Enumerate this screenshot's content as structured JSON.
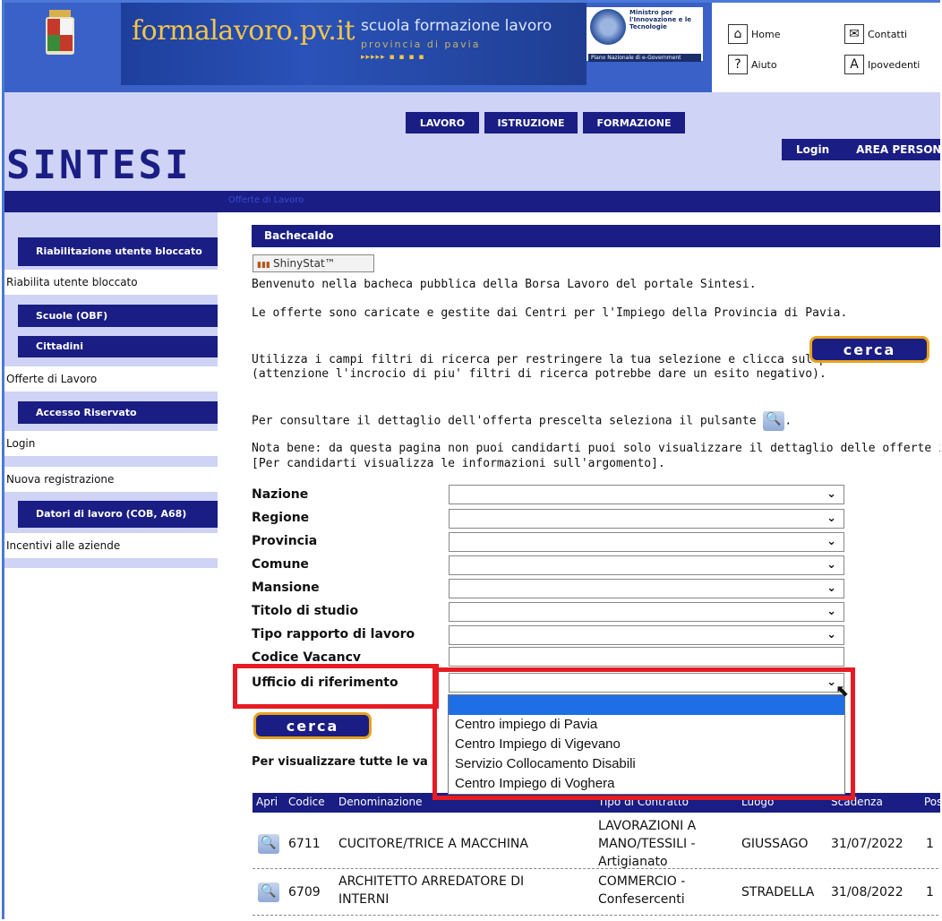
{
  "banner": {
    "brand_name": "formalavoro.pv.it",
    "brand_sub": "scuola formazione lavoro",
    "brand_sub2": "provincia di pavia",
    "brand_dots": "▸▸▸▸▸ ▪ ▪ ▪ ▪",
    "ministry_text": "Ministro per l'Innovazione e le Tecnologie",
    "ministry_bar": "Piano Nazionale di e-Government",
    "links": {
      "home": "Home",
      "contatti": "Contatti",
      "aiuto": "Aiuto",
      "ipovedenti": "Ipovedenti"
    }
  },
  "nav": {
    "lavoro": "LAVORO",
    "istruzione": "ISTRUZIONE",
    "formazione": "FORMAZIONE",
    "logo": "SINTESI",
    "login": "Login",
    "area": "AREA PERSONALE",
    "breadcrumb": "Offerte di Lavoro"
  },
  "sidebar": {
    "h1": "Riabilitazione utente bloccato",
    "l1": "Riabilita utente bloccato",
    "h2": "Scuole (OBF)",
    "h3": "Cittadini",
    "l3": "Offerte di Lavoro",
    "h4": "Accesso Riservato",
    "l4a": "Login",
    "l4b": "Nuova registrazione",
    "h5": "Datori di lavoro (COB, A68)",
    "l5": "Incentivi alle aziende"
  },
  "main": {
    "header": "BachecaIdo",
    "shiny": "ShinyStat™",
    "p1": "Benvenuto nella bacheca pubblica della Borsa Lavoro del portale Sintesi.",
    "p2": "Le offerte sono caricate e gestite dai Centri per l'Impiego della Provincia di Pavia.",
    "p3a": "Utilizza i campi filtri di ricerca per restringere la tua selezione e clicca sul pulsante",
    "p3b": "(attenzione l'incrocio di piu' filtri di ricerca potrebbe dare un esito negativo).",
    "p4": "Per consultare il dettaglio dell'offerta prescelta seleziona il pulsante",
    "p4end": ".",
    "p5a": "Nota bene: da questa pagina non puoi candidarti puoi solo visualizzare il dettaglio delle offerte in elenco",
    "p5b": "[Per candidarti visualizza le informazioni sull'argomento].",
    "cerca": "cerca",
    "visualizza": "Per visualizzare tutte le va"
  },
  "filters": {
    "nazione": "Nazione",
    "regione": "Regione",
    "provincia": "Provincia",
    "comune": "Comune",
    "mansione": "Mansione",
    "titolo": "Titolo di studio",
    "tipo": "Tipo rapporto di lavoro",
    "codice": "Codice Vacancy",
    "ufficio": "Ufficio di riferimento"
  },
  "dropdown": {
    "options": [
      "Centro impiego di Pavia",
      "Centro Impiego di Vigevano",
      "Servizio Collocamento Disabili",
      "Centro Impiego di Voghera"
    ]
  },
  "table": {
    "headers": {
      "apri": "Apri",
      "codice": "Codice",
      "denominazione": "Denominazione",
      "tipo": "Tipo di Contratto",
      "luogo": "Luogo",
      "scadenza": "Scadenza",
      "pos": "Pos"
    },
    "rows": [
      {
        "codice": "6711",
        "denominazione": "CUCITORE/TRICE A MACCHINA",
        "tipo1": "LAVORAZIONI A",
        "tipo2": "MANO/TESSILI -",
        "tipo3": "Artigianato",
        "luogo": "GIUSSAGO",
        "scadenza": "31/07/2022",
        "pos": "1"
      },
      {
        "codice": "6709",
        "den1": "ARCHITETTO ARREDATORE DI",
        "den2": "INTERNI",
        "tipo1": "COMMERCIO -",
        "tipo2": "Confesercenti",
        "luogo": "STRADELLA",
        "scadenza": "31/08/2022",
        "pos": "1"
      }
    ]
  }
}
